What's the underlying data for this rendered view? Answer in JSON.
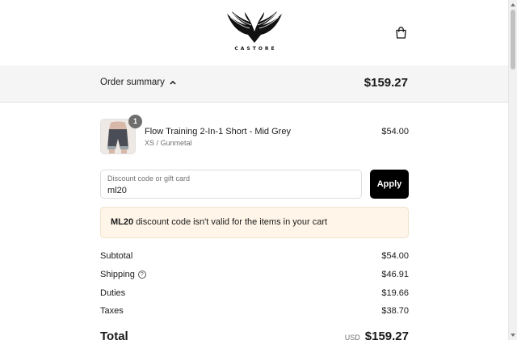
{
  "brand": {
    "name": "CASTORE"
  },
  "summary": {
    "toggle_label": "Order summary",
    "total": "$159.27"
  },
  "item": {
    "quantity": "1",
    "name": "Flow Training 2-In-1 Short - Mid Grey",
    "variant": "XS / Gunmetal",
    "price": "$54.00"
  },
  "discount": {
    "label": "Discount code or gift card",
    "value": "ml20",
    "apply_label": "Apply"
  },
  "alert": {
    "code": "ML20",
    "message": " discount code isn't valid for the items in your cart"
  },
  "totals": {
    "subtotal_label": "Subtotal",
    "subtotal_value": "$54.00",
    "shipping_label": "Shipping",
    "shipping_value": "$46.91",
    "duties_label": "Duties",
    "duties_value": "$19.66",
    "taxes_label": "Taxes",
    "taxes_value": "$38.70",
    "total_label": "Total",
    "total_currency": "USD",
    "total_value": "$159.27"
  },
  "icons": {
    "bag": "shopping-bag-icon",
    "chevron": "chevron-up-icon",
    "help": "question-circle-icon"
  }
}
